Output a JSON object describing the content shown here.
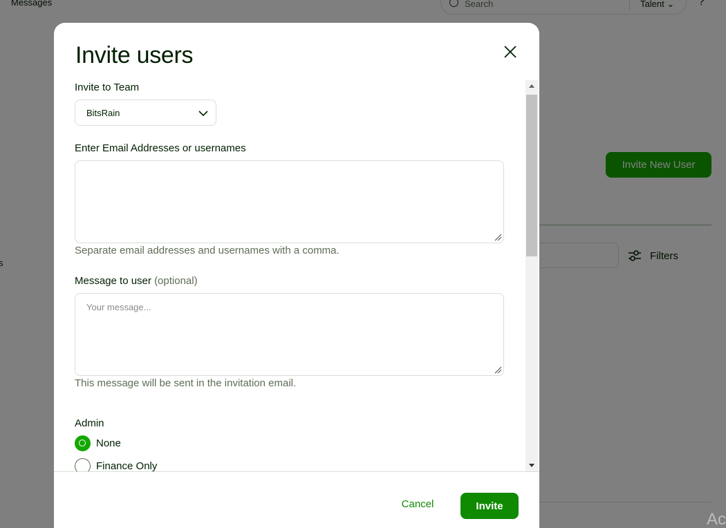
{
  "background": {
    "nav_messages": "Messages",
    "search_placeholder": "Search",
    "search_scope": "Talent",
    "help": "?",
    "invite_new_user_label": "Invite New User",
    "filters_label": "Filters",
    "edge_text": "s",
    "corner_text": "Ac"
  },
  "modal": {
    "title": "Invite users",
    "team": {
      "label": "Invite to Team",
      "selected": "BitsRain"
    },
    "emails": {
      "label": "Enter Email Addresses or usernames",
      "value": "",
      "help": "Separate email addresses and usernames with a comma."
    },
    "message": {
      "label": "Message to user",
      "label_optional": "(optional)",
      "placeholder": "Your message...",
      "help": "This message will be sent in the invitation email."
    },
    "admin": {
      "label": "Admin",
      "options": [
        {
          "label": "None",
          "selected": true
        },
        {
          "label": "Finance Only",
          "selected": false
        }
      ]
    },
    "footer": {
      "cancel_label": "Cancel",
      "invite_label": "Invite"
    }
  },
  "colors": {
    "primary": "#108a00",
    "accent": "#14a800",
    "border": "#d5e0d5",
    "text": "#001e00",
    "muted": "#5e6d55"
  },
  "icons": [
    "search-icon",
    "chevron-down-icon",
    "filters-icon",
    "close-icon",
    "resize-grip-icon",
    "scroll-up-icon",
    "scroll-down-icon"
  ]
}
